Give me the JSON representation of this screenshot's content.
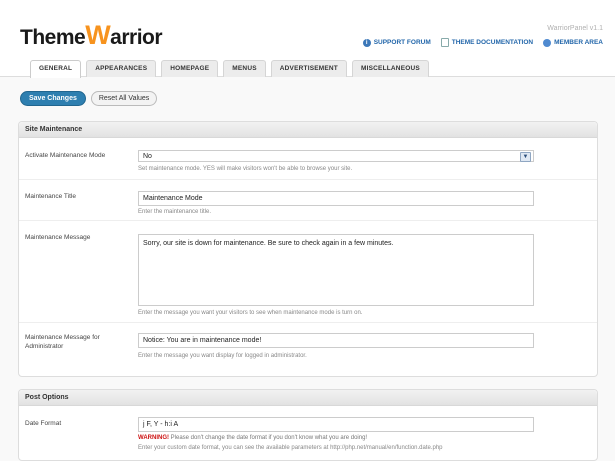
{
  "app": {
    "logo_part1": "Theme",
    "logo_w": "W",
    "logo_part2": "arrior",
    "version": "WarriorPanel v1.1"
  },
  "toplinks": [
    {
      "label": "SUPPORT FORUM",
      "icon": "info-icon"
    },
    {
      "label": "THEME DOCUMENTATION",
      "icon": "document-icon"
    },
    {
      "label": "MEMBER AREA",
      "icon": "user-icon"
    }
  ],
  "tabs": [
    {
      "label": "GENERAL",
      "active": true
    },
    {
      "label": "APPEARANCES"
    },
    {
      "label": "HOMEPAGE"
    },
    {
      "label": "MENUS"
    },
    {
      "label": "ADVERTISEMENT"
    },
    {
      "label": "MISCELLANEOUS"
    }
  ],
  "actions": {
    "save": "Save Changes",
    "reset": "Reset All Values"
  },
  "maintenance": {
    "title": "Site Maintenance",
    "mode": {
      "label": "Activate Maintenance Mode",
      "value": "No",
      "help": "Set maintenance mode. YES will make visitors won't be able to browse your site."
    },
    "title_field": {
      "label": "Maintenance Title",
      "value": "Maintenance Mode",
      "help": "Enter the maintenance title."
    },
    "message": {
      "label": "Maintenance Message",
      "value": "Sorry, our site is down for maintenance. Be sure to check again in a few minutes.",
      "help": "Enter the message you want your visitors to see when maintenance mode is turn on."
    },
    "admin_message": {
      "label": "Maintenance Message for Administrator",
      "value": "Notice: You are in maintenance mode!",
      "help": "Enter the message you want display for logged in administrator."
    }
  },
  "post_options": {
    "title": "Post Options",
    "date_format": {
      "label": "Date Format",
      "value": "j F, Y - h:i A",
      "warning_label": "WARNING!",
      "warning_text": " Please don't change the date format if you don't know what you are doing!",
      "help": "Enter your custom date format, you can see the available parameters at http://php.net/manual/en/function.date.php"
    }
  },
  "colors": {
    "accent": "#2e7fb0",
    "logo_orange": "#f7931e",
    "link": "#2266aa",
    "warning": "#cc1111"
  }
}
